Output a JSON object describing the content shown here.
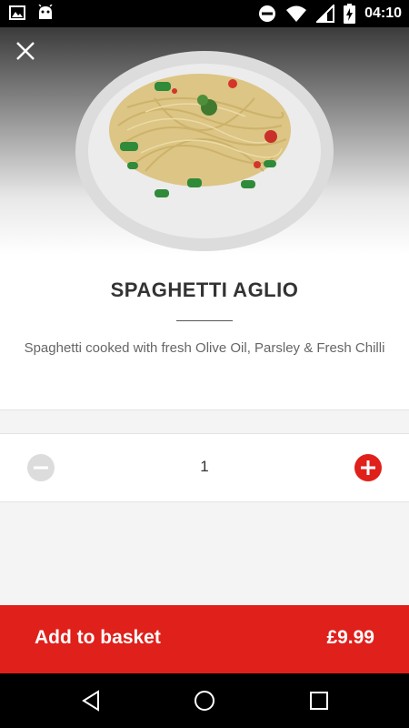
{
  "status_bar": {
    "time": "04:10",
    "icons_left": [
      "image-icon",
      "android-icon"
    ],
    "icons_right": [
      "dnd-icon",
      "wifi-icon",
      "signal-icon",
      "battery-charging-icon"
    ]
  },
  "product": {
    "name": "SPAGHETTI AGLIO",
    "description": "Spaghetti cooked with fresh Olive Oil, Parsley & Fresh Chilli",
    "image": "spaghetti-plate"
  },
  "quantity": {
    "value": "1",
    "minus_enabled": false
  },
  "basket": {
    "label": "Add to basket",
    "price": "£9.99"
  },
  "nav_bar": {
    "buttons": [
      "back-icon",
      "home-icon",
      "recents-icon"
    ]
  },
  "colors": {
    "accent": "#e0201b",
    "disabled": "#dcdcdc",
    "background": "#f4f4f4"
  }
}
